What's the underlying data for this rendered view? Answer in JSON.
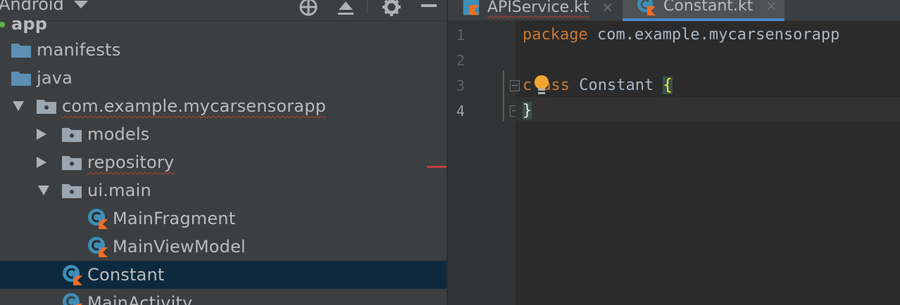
{
  "project": {
    "view_name": "Android",
    "tree": [
      {
        "label": "app",
        "kind": "module"
      },
      {
        "label": "manifests",
        "kind": "folder"
      },
      {
        "label": "java",
        "kind": "folder"
      },
      {
        "label": "com.example.mycarsensorapp",
        "kind": "package",
        "expanded": true
      },
      {
        "label": "models",
        "kind": "package",
        "expanded": false
      },
      {
        "label": "repository",
        "kind": "package",
        "expanded": false
      },
      {
        "label": "ui.main",
        "kind": "package",
        "expanded": true
      },
      {
        "label": "MainFragment",
        "kind": "kotlin-class"
      },
      {
        "label": "MainViewModel",
        "kind": "kotlin-class"
      },
      {
        "label": "Constant",
        "kind": "kotlin-class",
        "selected": true
      },
      {
        "label": "MainActivity",
        "kind": "kotlin-class"
      }
    ]
  },
  "editor": {
    "tabs": [
      {
        "label": "APIService.kt",
        "active": false,
        "close": "×"
      },
      {
        "label": "Constant.kt",
        "active": true,
        "close": "×"
      }
    ],
    "line_numbers": [
      "1",
      "2",
      "3",
      "4"
    ],
    "code": {
      "line1_keyword": "package",
      "line1_rest": " com.example.mycarsensorapp",
      "line3_keyword_a": "c",
      "line3_keyword_b": "ass",
      "line3_name": " Constant ",
      "line3_brace": "{",
      "line4_brace": "}"
    }
  },
  "colors": {
    "panel_bg": "#3c3f41",
    "editor_bg": "#2b2b2b",
    "selection": "#0d293e",
    "keyword": "#cc7832",
    "folder_blue": "#5c8fb3",
    "kotlin_orange": "#f26d26",
    "error": "#bc3f3c"
  },
  "icons": {
    "toolbar": [
      "target-icon",
      "collapse-icon",
      "gear-icon",
      "minimize-icon"
    ],
    "editor": [
      "intention-bulb-icon"
    ]
  }
}
